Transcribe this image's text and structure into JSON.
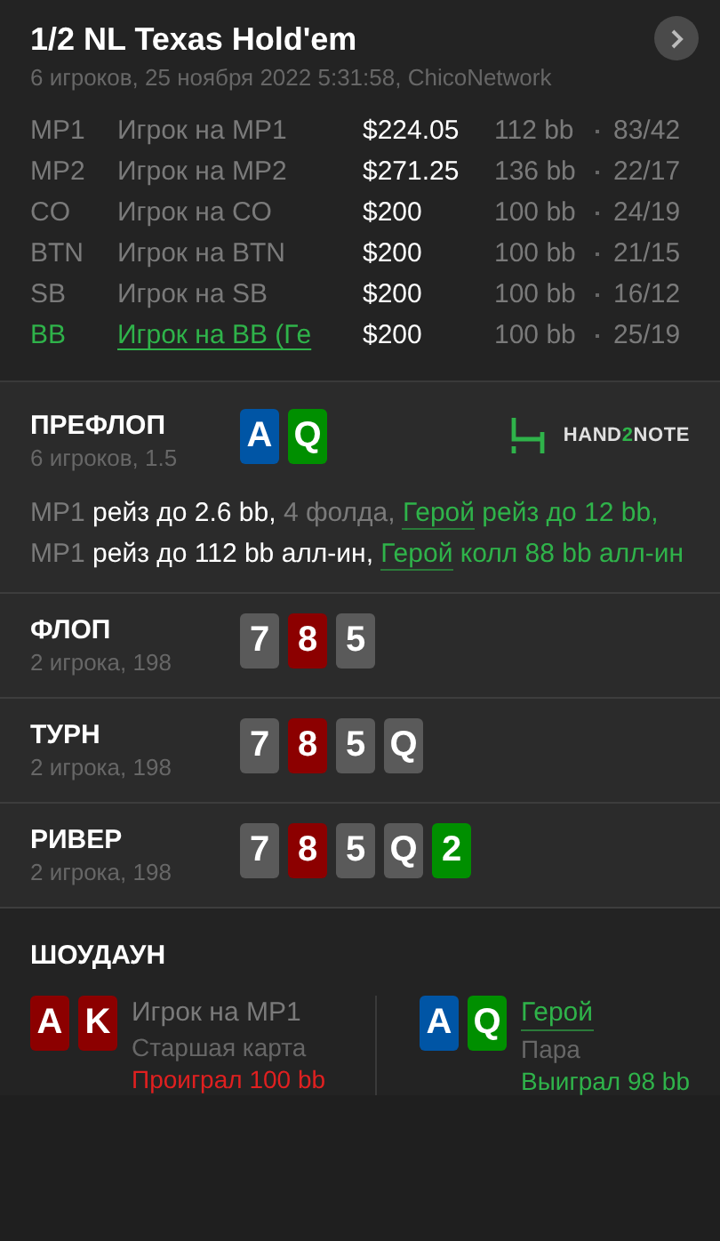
{
  "header": {
    "title": "1/2 NL Texas Hold'em",
    "subtitle": "6 игроков, 25 ноября 2022 5:31:58, ChicoNetwork"
  },
  "players": [
    {
      "position": "MP1",
      "name": "Игрок на MP1",
      "stack": "$224.05",
      "bb": "112 bb",
      "stats": "83/42",
      "hero": false
    },
    {
      "position": "MP2",
      "name": "Игрок на MP2",
      "stack": "$271.25",
      "bb": "136 bb",
      "stats": "22/17",
      "hero": false
    },
    {
      "position": "CO",
      "name": "Игрок на CO",
      "stack": "$200",
      "bb": "100 bb",
      "stats": "24/19",
      "hero": false
    },
    {
      "position": "BTN",
      "name": "Игрок на BTN",
      "stack": "$200",
      "bb": "100 bb",
      "stats": "21/15",
      "hero": false
    },
    {
      "position": "SB",
      "name": "Игрок на SB",
      "stack": "$200",
      "bb": "100 bb",
      "stats": "16/12",
      "hero": false
    },
    {
      "position": "BB",
      "name": "Игрок на BB (Ге",
      "stack": "$200",
      "bb": "100 bb",
      "stats": "25/19",
      "hero": true
    }
  ],
  "preflop": {
    "title": "ПРЕФЛОП",
    "subtitle": "6 игроков, 1.5",
    "cards": [
      {
        "rank": "A",
        "color": "#0055a5"
      },
      {
        "rank": "Q",
        "color": "#008f00"
      }
    ],
    "logo": {
      "part1": "HAND",
      "part2": "2",
      "part3": "NOTE"
    },
    "actions": [
      {
        "kind": "pos",
        "text": "MP1 "
      },
      {
        "kind": "act",
        "text": "рейз до 2.6 bb, "
      },
      {
        "kind": "fold",
        "text": "4 фолда, "
      },
      {
        "kind": "hero",
        "text": "Герой"
      },
      {
        "kind": "heroact",
        "text": " рейз до 12 bb, "
      },
      {
        "kind": "pos",
        "text": "MP1 "
      },
      {
        "kind": "act",
        "text": "рейз до 112 bb алл-ин, "
      },
      {
        "kind": "hero",
        "text": "Герой"
      },
      {
        "kind": "heroact",
        "text": " колл 88 bb алл-ин"
      }
    ]
  },
  "streets": [
    {
      "title": "ФЛОП",
      "subtitle": "2 игрока, 198",
      "cards": [
        {
          "rank": "7",
          "color": "#5a5a5a"
        },
        {
          "rank": "8",
          "color": "#8c0000"
        },
        {
          "rank": "5",
          "color": "#5a5a5a"
        }
      ]
    },
    {
      "title": "ТУРН",
      "subtitle": "2 игрока, 198",
      "cards": [
        {
          "rank": "7",
          "color": "#5a5a5a"
        },
        {
          "rank": "8",
          "color": "#8c0000"
        },
        {
          "rank": "5",
          "color": "#5a5a5a"
        },
        {
          "rank": "Q",
          "color": "#5a5a5a"
        }
      ]
    },
    {
      "title": "РИВЕР",
      "subtitle": "2 игрока, 198",
      "cards": [
        {
          "rank": "7",
          "color": "#5a5a5a"
        },
        {
          "rank": "8",
          "color": "#8c0000"
        },
        {
          "rank": "5",
          "color": "#5a5a5a"
        },
        {
          "rank": "Q",
          "color": "#5a5a5a"
        },
        {
          "rank": "2",
          "color": "#008f00"
        }
      ]
    }
  ],
  "showdown": {
    "title": "ШОУДАУН",
    "hands": [
      {
        "cards": [
          {
            "rank": "A",
            "color": "#8c0000"
          },
          {
            "rank": "K",
            "color": "#8c0000"
          }
        ],
        "name": "Игрок на MP1",
        "combo": "Старшая карта",
        "result": "Проиграл 100 bb",
        "hero": false,
        "won": false
      },
      {
        "cards": [
          {
            "rank": "A",
            "color": "#0055a5"
          },
          {
            "rank": "Q",
            "color": "#008f00"
          }
        ],
        "name": "Герой",
        "combo": "Пара",
        "result": "Выиграл 98 bb",
        "hero": true,
        "won": true
      }
    ]
  }
}
